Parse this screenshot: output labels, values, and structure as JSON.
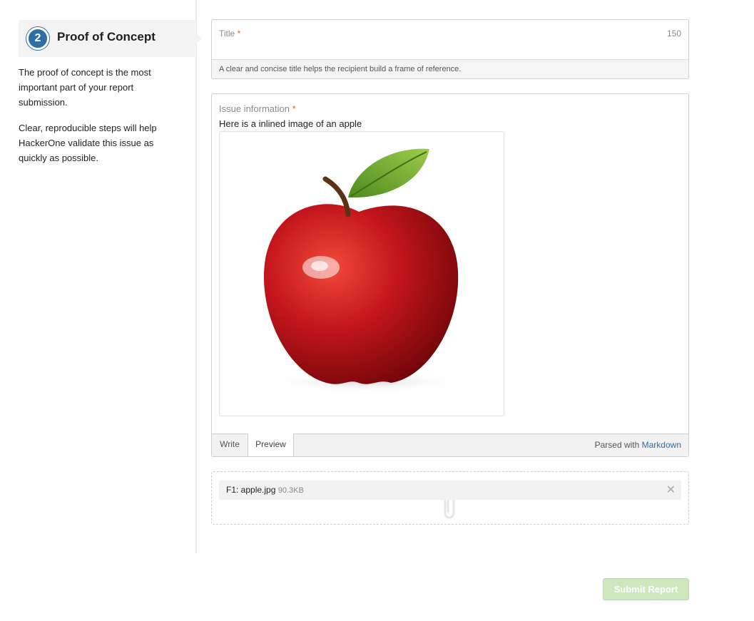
{
  "sidebar": {
    "step_number": "2",
    "step_title": "Proof of Concept",
    "paragraph_1": "The proof of concept is the most important part of your report submission.",
    "paragraph_2": "Clear, reproducible steps will help HackerOne validate this issue as quickly as possible."
  },
  "title_field": {
    "label": "Title",
    "required_mark": "*",
    "char_count": "150",
    "value": "",
    "help": "A clear and concise title helps the recipient build a frame of reference."
  },
  "issue_field": {
    "label": "Issue information",
    "required_mark": "*",
    "preview_text": "Here is a inlined image of an apple",
    "tabs": [
      "Write",
      "Preview"
    ],
    "active_tab": "Preview",
    "parsed_prefix": "Parsed with",
    "parsed_link": "Markdown"
  },
  "attachments": {
    "files": [
      {
        "name": "F1: apple.jpg",
        "size": "90.3KB"
      }
    ],
    "remove_glyph": "✕"
  },
  "submit_button": {
    "label": "Submit Report"
  },
  "colors": {
    "accent": "#2f6ea5",
    "required": "#d9652b",
    "submit_disabled": "#cde8bd"
  }
}
